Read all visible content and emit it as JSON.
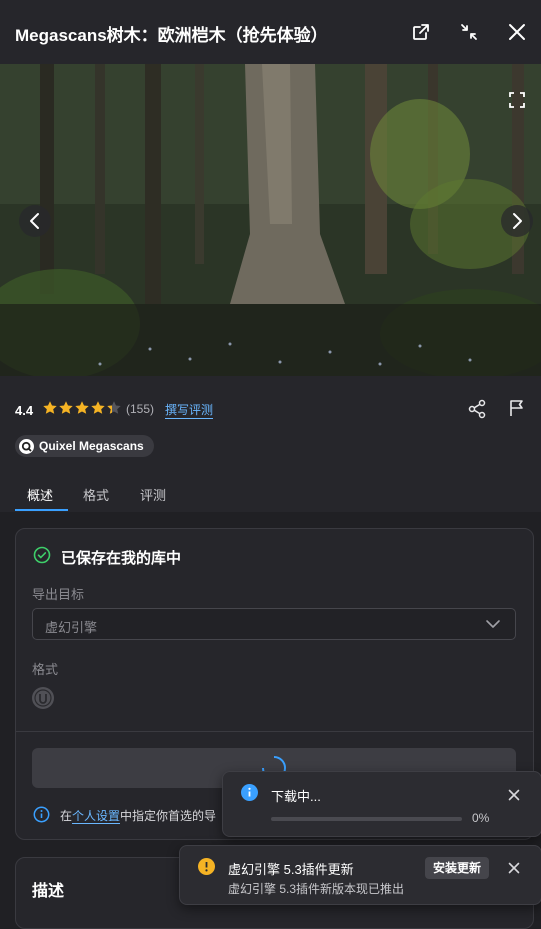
{
  "header": {
    "title": "Megascans树木：欧洲桤木（抢先体验）"
  },
  "icons": {
    "open_external": "external-link-icon",
    "collapse": "collapse-icon",
    "close": "close-icon",
    "fullscreen": "fullscreen-icon",
    "prev": "chevron-left-icon",
    "next": "chevron-right-icon",
    "share": "share-icon",
    "report": "flag-icon"
  },
  "rating": {
    "value": "4.4",
    "stars": 4.4,
    "count": "(155)",
    "write_review": "撰写评测"
  },
  "publisher": {
    "name": "Quixel Megascans"
  },
  "tabs": [
    {
      "label": "概述",
      "active": true
    },
    {
      "label": "格式",
      "active": false
    },
    {
      "label": "评测",
      "active": false
    }
  ],
  "library": {
    "status": "已保存在我的库中",
    "export_target_label": "导出目标",
    "export_target_value": "虚幻引擎",
    "format_label": "格式",
    "note_prefix": "在",
    "note_link": "个人设置",
    "note_suffix": "中指定你首选的导"
  },
  "description": {
    "title": "描述"
  },
  "download_toast": {
    "title": "下载中...",
    "progress": 0,
    "percent_label": "0%"
  },
  "update_toast": {
    "title": "虚幻引擎 5.3插件更新",
    "subtitle": "虚幻引擎 5.3插件新版本现已推出",
    "button": "安装更新"
  },
  "colors": {
    "accent": "#3aa0ff",
    "star": "#f5b324",
    "success": "#3ecf6a",
    "warning": "#f5b324",
    "info": "#3aa0ff"
  }
}
